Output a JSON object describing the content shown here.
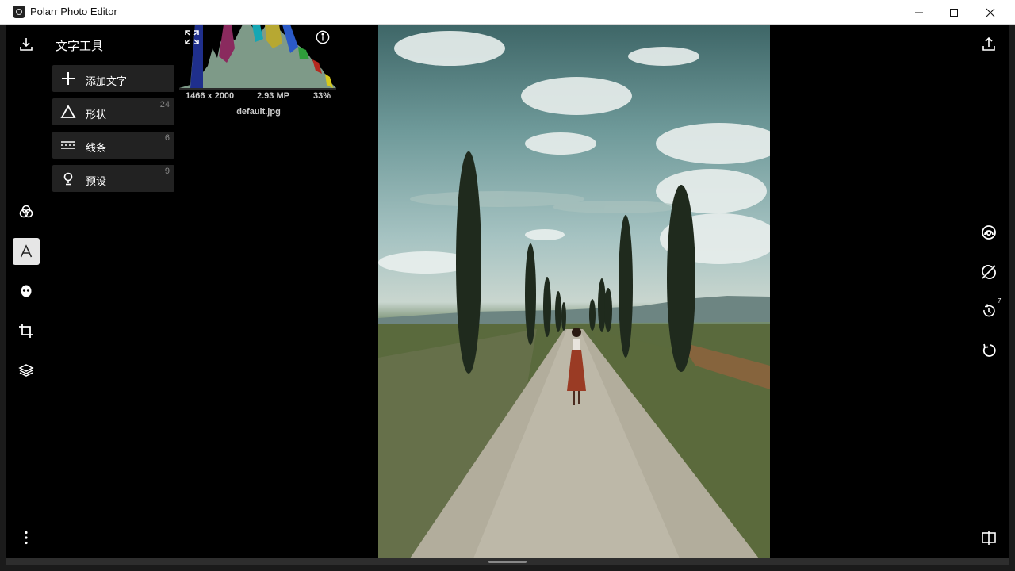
{
  "window": {
    "title": "Polarr Photo Editor"
  },
  "panel": {
    "title": "文字工具",
    "items": [
      {
        "label": "添加文字",
        "count": ""
      },
      {
        "label": "形状",
        "count": "24"
      },
      {
        "label": "线条",
        "count": "6"
      },
      {
        "label": "预设",
        "count": "9"
      }
    ]
  },
  "image_info": {
    "dimensions": "1466 x 2000",
    "megapixels": "2.93 MP",
    "zoom": "33%",
    "filename": "default.jpg"
  },
  "right_tools": {
    "history_count": "7"
  },
  "colors": {
    "app_background": "#000000",
    "panel_item": "#222222",
    "active_tool": "#e6e6e6"
  }
}
